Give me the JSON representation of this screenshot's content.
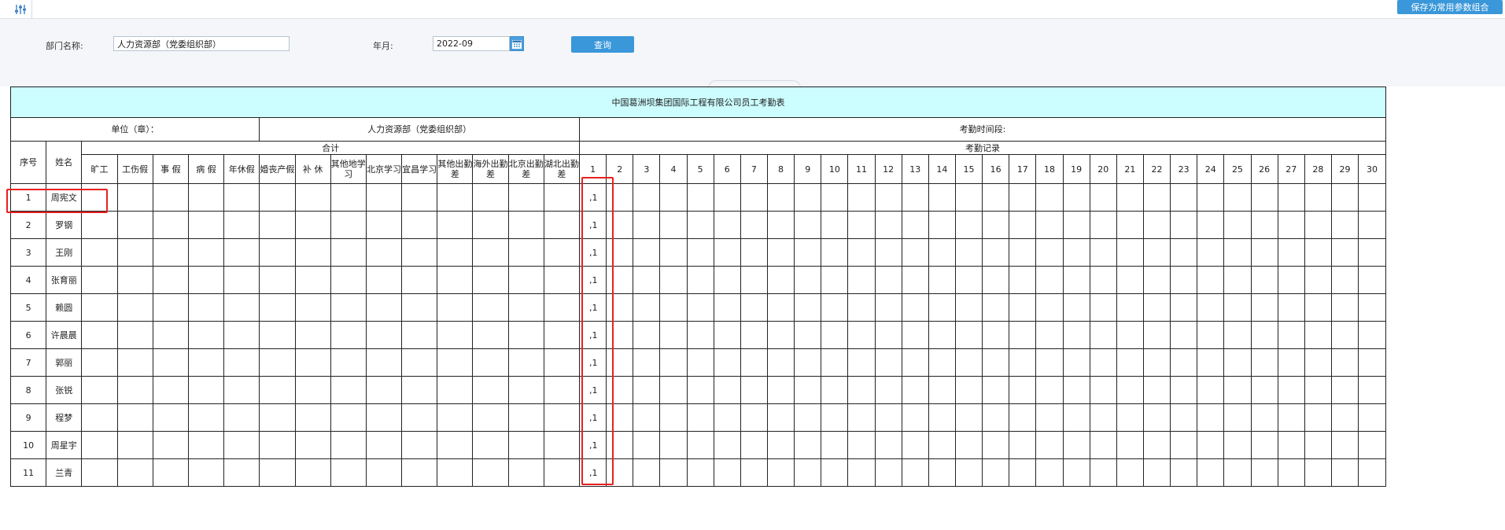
{
  "toolbar": {
    "filter_icon": "sliders-icon",
    "save_params_label": "保存为常用参数组合"
  },
  "filters": {
    "dept_label": "部门名称:",
    "dept_value": "人力资源部（党委组织部）",
    "month_label": "年月:",
    "month_value": "2022-09",
    "calendar_icon": "calendar-icon",
    "query_label": "查询"
  },
  "report": {
    "title": "中国葛洲坝集团国际工程有限公司员工考勤表",
    "unit_label": "单位（章）：",
    "unit_dept": "人力资源部（党委组织部）",
    "period_label": "考勤时间段:",
    "seq_header": "序号",
    "name_header": "姓名",
    "total_header": "合计",
    "records_header": "考勤记录",
    "leave_columns": [
      "旷工",
      "工伤假",
      "事 假",
      "病 假",
      "年休假",
      "婚丧产假",
      "补 休",
      "其他地学习",
      "北京学习",
      "宜昌学习",
      "其他出勤差",
      "海外出勤差",
      "北京出勤差",
      "湖北出勤差"
    ],
    "days": [
      "1",
      "2",
      "3",
      "4",
      "5",
      "6",
      "7",
      "8",
      "9",
      "10",
      "11",
      "12",
      "13",
      "14",
      "15",
      "16",
      "17",
      "18",
      "19",
      "20",
      "21",
      "22",
      "23",
      "24",
      "25",
      "26",
      "27",
      "28",
      "29",
      "30"
    ],
    "rows": [
      {
        "seq": "1",
        "name": "周宪文",
        "day1": ",1"
      },
      {
        "seq": "2",
        "name": "罗钢",
        "day1": ",1"
      },
      {
        "seq": "3",
        "name": "王刚",
        "day1": ",1"
      },
      {
        "seq": "4",
        "name": "张育丽",
        "day1": ",1"
      },
      {
        "seq": "5",
        "name": "赖圆",
        "day1": ",1"
      },
      {
        "seq": "6",
        "name": "许晨晨",
        "day1": ",1"
      },
      {
        "seq": "7",
        "name": "郭丽",
        "day1": ",1"
      },
      {
        "seq": "8",
        "name": "张锐",
        "day1": ",1"
      },
      {
        "seq": "9",
        "name": "程梦",
        "day1": ",1"
      },
      {
        "seq": "10",
        "name": "周星宇",
        "day1": ",1"
      },
      {
        "seq": "11",
        "name": "兰青",
        "day1": ",1"
      }
    ]
  },
  "colors": {
    "title_bg": "#ccfdff",
    "button_blue": "#3a97d9",
    "highlight_red": "#e8211f"
  }
}
